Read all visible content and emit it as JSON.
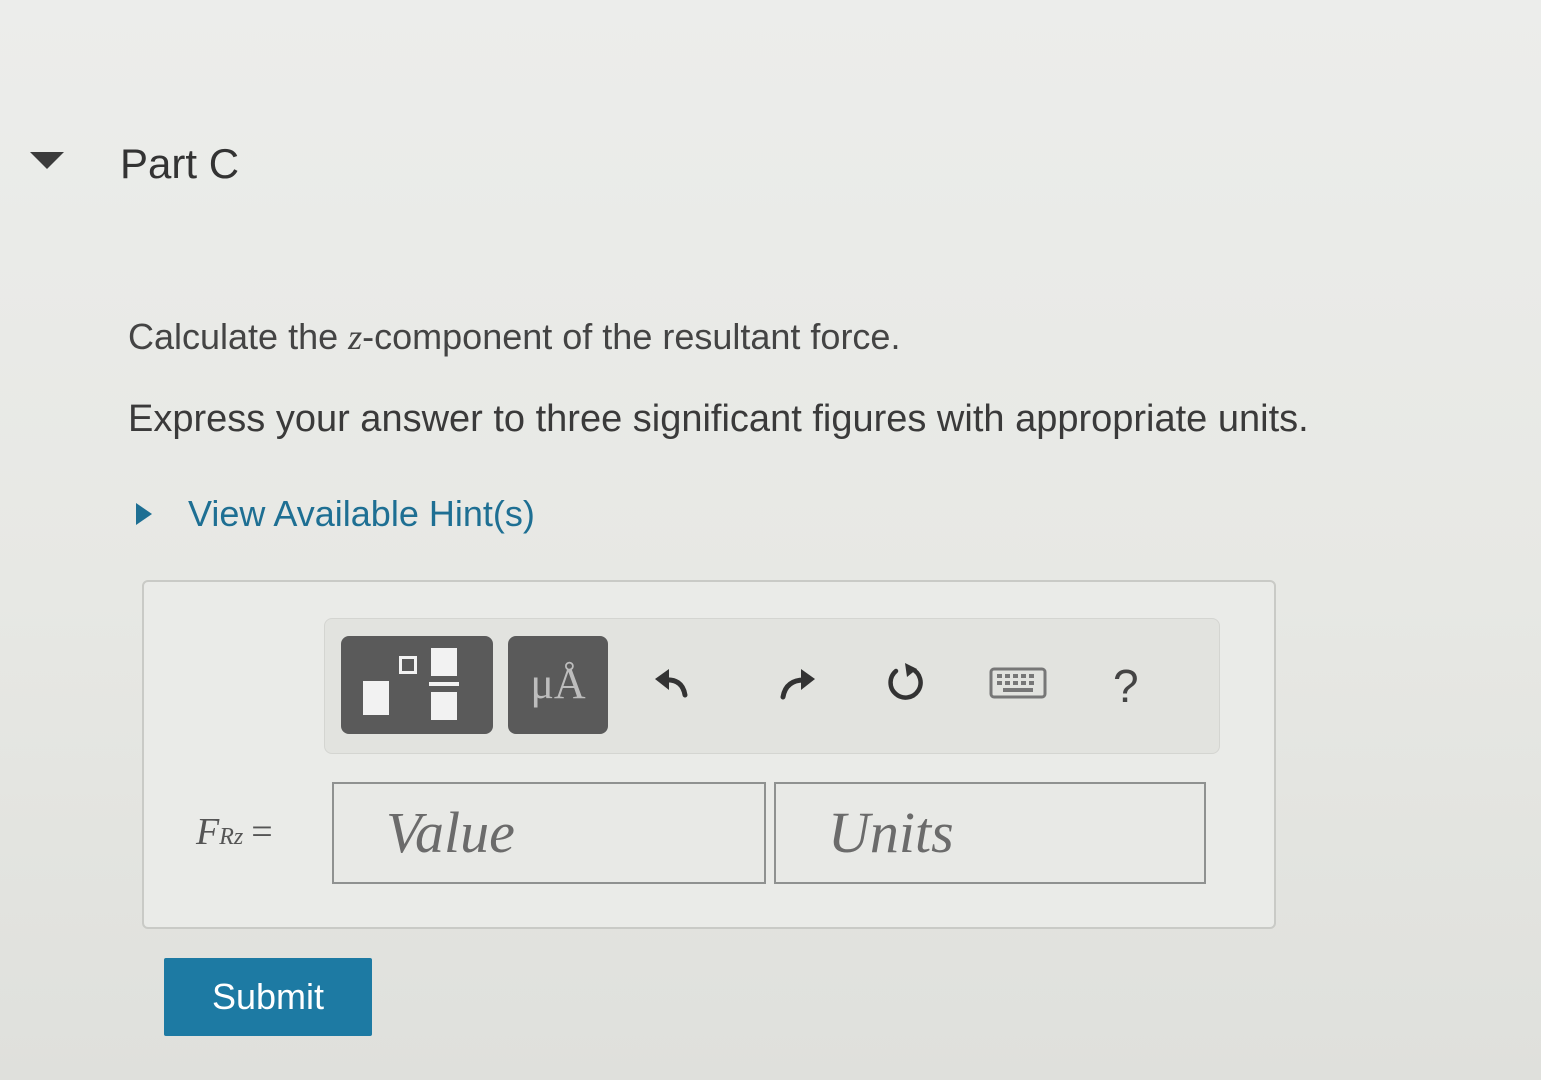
{
  "part": {
    "title": "Part C"
  },
  "question": {
    "prompt_before": "Calculate the ",
    "prompt_variable": "z",
    "prompt_after": "-component of the resultant force.",
    "instructions": "Express your answer to three significant figures with appropriate units."
  },
  "hint": {
    "label": "View Available Hint(s)"
  },
  "toolbar": {
    "symbols_label": "μÅ",
    "help_label": "?",
    "icons": [
      "templates-icon",
      "symbols-icon",
      "undo-icon",
      "redo-icon",
      "reset-icon",
      "keyboard-icon",
      "help-icon"
    ]
  },
  "answer": {
    "variable": "F",
    "variable_subscript": "Rz",
    "equals": "=",
    "value_placeholder": "Value",
    "units_placeholder": "Units"
  },
  "submit": {
    "label": "Submit"
  },
  "colors": {
    "link": "#1e6f93",
    "submit_bg": "#1d7aa3",
    "toolbar_button_bg": "#5a5a5a"
  }
}
